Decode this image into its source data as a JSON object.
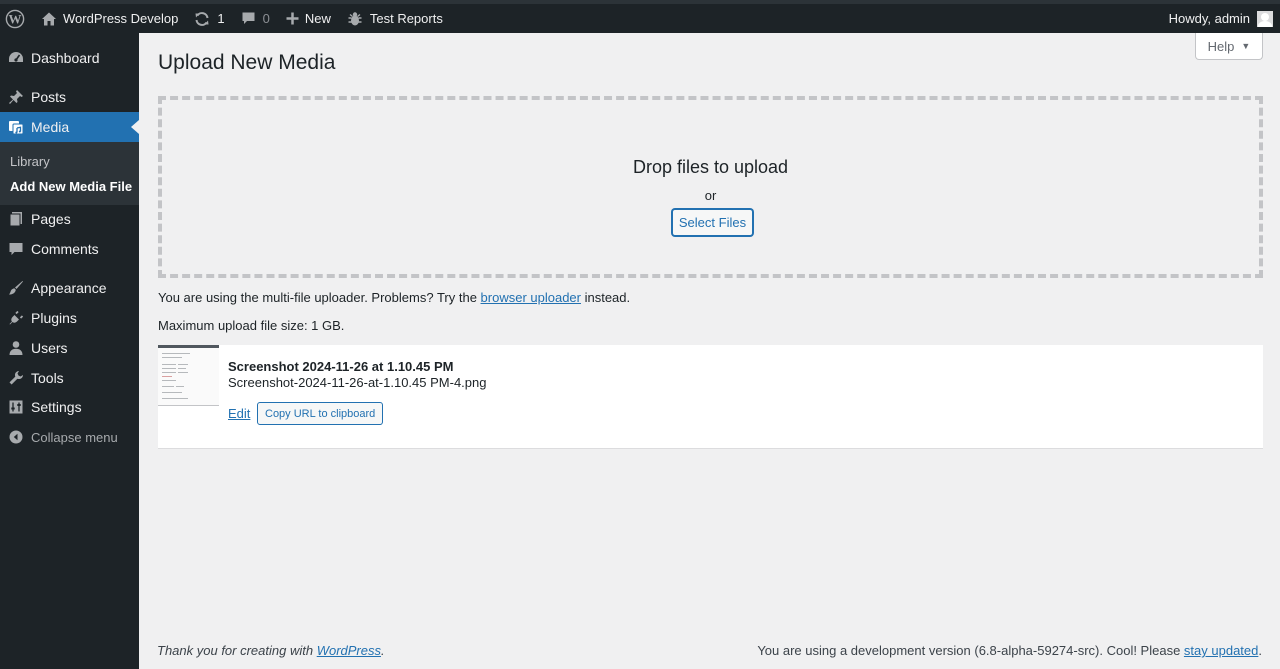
{
  "admin_bar": {
    "site_name": "WordPress Develop",
    "updates_count": "1",
    "comments_count": "0",
    "new_label": "New",
    "test_reports_label": "Test Reports",
    "howdy": "Howdy, admin"
  },
  "sidebar": {
    "items": [
      {
        "label": "Dashboard",
        "icon": "dashboard-icon"
      },
      {
        "label": "Posts",
        "icon": "pushpin-icon"
      },
      {
        "label": "Media",
        "icon": "media-icon"
      },
      {
        "label": "Pages",
        "icon": "pages-icon"
      },
      {
        "label": "Comments",
        "icon": "comment-icon"
      },
      {
        "label": "Appearance",
        "icon": "paintbrush-icon"
      },
      {
        "label": "Plugins",
        "icon": "plug-icon"
      },
      {
        "label": "Users",
        "icon": "user-icon"
      },
      {
        "label": "Tools",
        "icon": "wrench-icon"
      },
      {
        "label": "Settings",
        "icon": "settings-icon"
      }
    ],
    "media_submenu": [
      "Library",
      "Add New Media File"
    ],
    "collapse_label": "Collapse menu"
  },
  "help_tab": {
    "label": "Help",
    "caret": "▼"
  },
  "page_title": "Upload New Media",
  "dropzone": {
    "title": "Drop files to upload",
    "or": "or",
    "button": "Select Files"
  },
  "uploader_note": {
    "before": "You are using the multi-file uploader. Problems? Try the ",
    "link": "browser uploader",
    "after": " instead."
  },
  "max_size": "Maximum upload file size: 1 GB.",
  "media_item": {
    "title": "Screenshot 2024-11-26 at 1.10.45 PM",
    "filename": "Screenshot-2024-11-26-at-1.10.45 PM-4.png",
    "edit_label": "Edit",
    "copy_label": "Copy URL to clipboard"
  },
  "footer": {
    "left_before": "Thank you for creating with ",
    "left_link": "WordPress",
    "left_after": ".",
    "right_before": "You are using a development version (6.8-alpha-59274-src). Cool! Please ",
    "right_link": "stay updated",
    "right_after": "."
  },
  "colors": {
    "admin_bar_bg": "#1d2327",
    "menu_current_bg": "#2271b1",
    "link": "#2271b1",
    "page_bg": "#f0f0f1"
  }
}
